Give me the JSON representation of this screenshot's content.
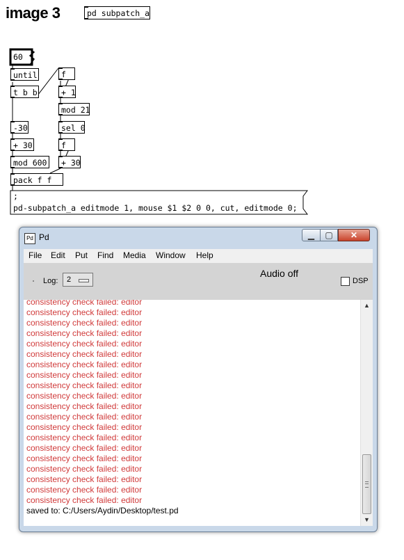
{
  "patch": {
    "title": "image 3",
    "subpatch_object": "pd subpatch_a",
    "objects": {
      "number_box": "60",
      "until": "until",
      "trigger": "t b b",
      "minus": "-30",
      "plus_30_left": "+ 30",
      "mod_600": "mod 600",
      "pack": "pack f f",
      "float_top": "f",
      "plus_1": "+ 1",
      "mod_21": "mod 21",
      "sel_0": "sel 0",
      "float_bottom": "f",
      "plus_30_right": "+ 30"
    },
    "message": {
      "line1": ";",
      "line2": "pd-subpatch_a editmode 1, mouse $1 $2 0 0, cut, editmode 0;"
    }
  },
  "pd_window": {
    "title": "Pd",
    "icon": "pd-app-icon",
    "controls": {
      "minimize": "minimize-icon",
      "maximize": "maximize-icon",
      "close": "close-icon"
    },
    "menu": [
      "File",
      "Edit",
      "Put",
      "Find",
      "Media",
      "Window",
      "Help"
    ],
    "log_label": "Log:",
    "log_level": "2",
    "audio_status": "Audio off",
    "dsp_label": "DSP",
    "dsp_checked": false,
    "console_lines": [
      "consistency check failed: editor",
      "consistency check failed: editor",
      "consistency check failed: editor",
      "consistency check failed: editor",
      "consistency check failed: editor",
      "consistency check failed: editor",
      "consistency check failed: editor",
      "consistency check failed: editor",
      "consistency check failed: editor",
      "consistency check failed: editor",
      "consistency check failed: editor",
      "consistency check failed: editor",
      "consistency check failed: editor",
      "consistency check failed: editor",
      "consistency check failed: editor",
      "consistency check failed: editor",
      "consistency check failed: editor",
      "consistency check failed: editor",
      "consistency check failed: editor",
      "consistency check failed: editor"
    ],
    "saved_line": "saved to: C:/Users/Aydin/Desktop/test.pd",
    "colors": {
      "error_text": "#d03a3a",
      "window_frame": "#c9d8e9",
      "close_button": "#c9432b"
    }
  }
}
